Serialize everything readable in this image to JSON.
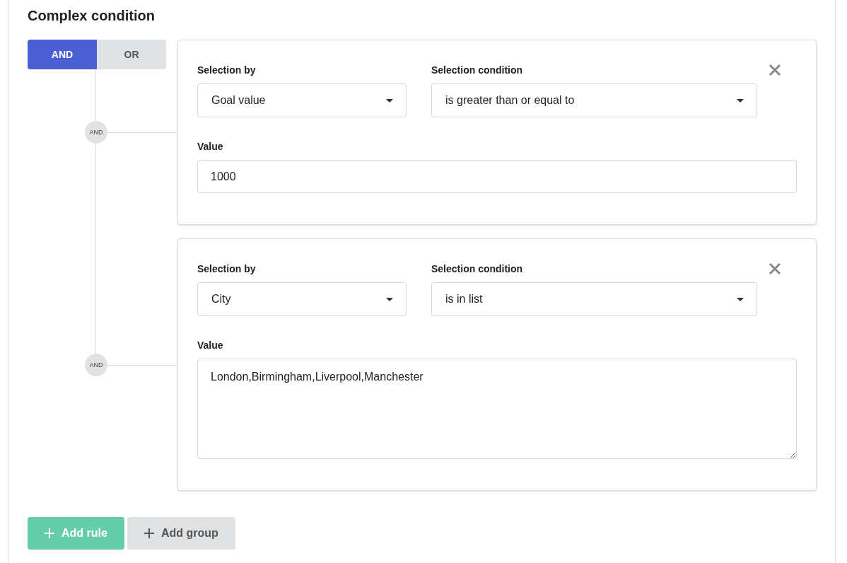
{
  "title": "Complex condition",
  "operators": [
    {
      "label": "AND",
      "selected": true
    },
    {
      "label": "OR",
      "selected": false
    }
  ],
  "rules": [
    {
      "connector": "AND",
      "selection_by_label": "Selection by",
      "selection_by": "Goal value",
      "condition_label": "Selection condition",
      "condition": "is greater than or equal to",
      "value_label": "Value",
      "kind": "input",
      "value": "1000"
    },
    {
      "connector": "AND",
      "selection_by_label": "Selection by",
      "selection_by": "City",
      "condition_label": "Selection condition",
      "condition": "is in list",
      "value_label": "Value",
      "kind": "textarea",
      "value": "London,Birmingham,Liverpool,Manchester"
    }
  ],
  "buttons": [
    {
      "kind": "primary",
      "label": "Add rule"
    },
    {
      "kind": "secondary",
      "label": "Add group"
    }
  ]
}
